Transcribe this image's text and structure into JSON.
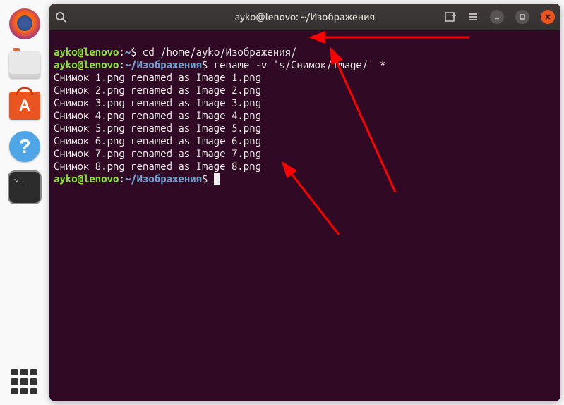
{
  "titlebar": {
    "title": "ayko@lenovo: ~/Изображения"
  },
  "dock": {
    "terminal_prompt": ">_"
  },
  "terminal": {
    "line1": {
      "user": "ayko@lenovo",
      "colon": ":",
      "path": "~",
      "dollar": "$ ",
      "cmd": "cd /home/ayko/Изображения/"
    },
    "line2": {
      "user": "ayko@lenovo",
      "colon": ":",
      "path": "~/Изображения",
      "dollar": "$ ",
      "cmd": "rename -v 's/Снимок/Image/' *"
    },
    "output": [
      "Снимок 1.png renamed as Image 1.png",
      "Снимок 2.png renamed as Image 2.png",
      "Снимок 3.png renamed as Image 3.png",
      "Снимок 4.png renamed as Image 4.png",
      "Снимок 5.png renamed as Image 5.png",
      "Снимок 6.png renamed as Image 6.png",
      "Снимок 7.png renamed as Image 7.png",
      "Снимок 8.png renamed as Image 8.png"
    ],
    "line3": {
      "user": "ayko@lenovo",
      "colon": ":",
      "path": "~/Изображения",
      "dollar": "$ "
    }
  }
}
